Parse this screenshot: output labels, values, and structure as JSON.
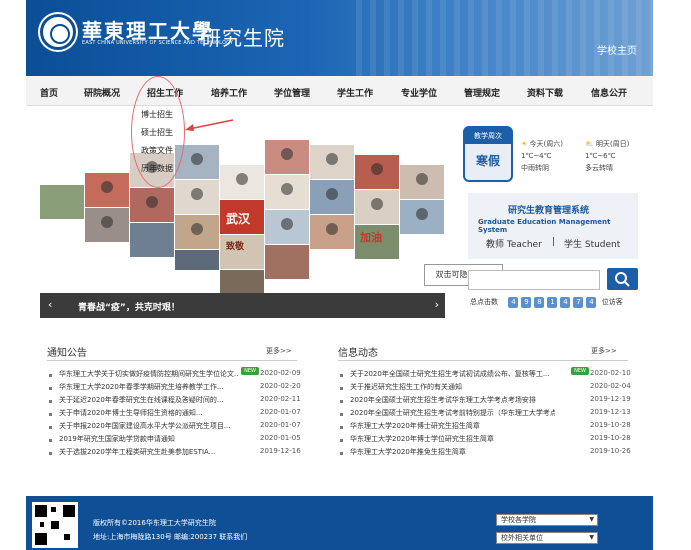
{
  "header": {
    "uni_name": "華東理工大學",
    "uni_en": "EAST CHINA UNIVERSITY OF SCIENCE AND TECHNOLOGY",
    "grad_title": "研究生院",
    "school_home": "学校主页"
  },
  "nav": {
    "items": [
      "首页",
      "研院概况",
      "招生工作",
      "培养工作",
      "学位管理",
      "学生工作",
      "专业学位",
      "管理规定",
      "资料下载",
      "信息公开"
    ]
  },
  "dropdown": {
    "items": [
      "博士招生",
      "硕士招生",
      "政策文件",
      "历年数据"
    ]
  },
  "slider": {
    "caption": "青春战“疫”，共克时艰！",
    "collage_text": [
      "武汉",
      "加油",
      "致敬"
    ]
  },
  "calendar": {
    "label": "教学周次",
    "value": "寒假"
  },
  "weather": {
    "today_label": "今天(周六)",
    "today_temp": "1℃~4℃",
    "today_desc": "中雨转阴",
    "tomorrow_label": "明天(周日)",
    "tomorrow_temp": "1℃~6℃",
    "tomorrow_desc": "多云转晴"
  },
  "gems": {
    "title": "研究生教育管理系统",
    "subtitle": "Graduate Education Management System",
    "teacher": "教师 Teacher",
    "separator": "|",
    "student": "学生 Student"
  },
  "tooltip": "双击可隐藏空白",
  "visits": {
    "label": "总点击数",
    "digits": [
      "4",
      "9",
      "8",
      "1",
      "4",
      "7",
      "4"
    ],
    "suffix": "位访客"
  },
  "notices": {
    "title": "通知公告",
    "more": "更多>>",
    "new_label": "NEW",
    "items": [
      {
        "text": "华东理工大学关于切实做好疫情防控期间研究生学位论文...",
        "date": "2020-02-09"
      },
      {
        "text": "华东理工大学2020年春季学期研究生培养教学工作...",
        "date": "2020-02-20"
      },
      {
        "text": "关于延迟2020年春季研究生在线课程及答疑时间的...",
        "date": "2020-02-11"
      },
      {
        "text": "关于申请2020年博士生导师招生资格的通知...",
        "date": "2020-01-07"
      },
      {
        "text": "关于申报2020年国家建设高水平大学公派研究生项目...",
        "date": "2020-01-07"
      },
      {
        "text": "2019年研究生国家助学贷款申请通知",
        "date": "2020-01-05"
      },
      {
        "text": "关于选拔2020学年工程类研究生赴美参加ESTIA...",
        "date": "2019-12-16"
      }
    ]
  },
  "news": {
    "title": "信息动态",
    "more": "更多>>",
    "new_label": "NEW",
    "items": [
      {
        "text": "关于2020年全国硕士研究生招生考试初试成绩公布、复核等工...",
        "date": "2020-02-10"
      },
      {
        "text": "关于推迟研究生招生工作的有关通知",
        "date": "2020-02-04"
      },
      {
        "text": "2020年全国硕士研究生招生考试华东理工大学考点考场安排",
        "date": "2019-12-19"
      },
      {
        "text": "2020年全国硕士研究生招生考试考前特别提示（华东理工大学考点）",
        "date": "2019-12-13"
      },
      {
        "text": "华东理工大学2020年博士研究生招生简章",
        "date": "2019-10-28"
      },
      {
        "text": "华东理工大学2020年博士学位研究生招生简章",
        "date": "2019-10-28"
      },
      {
        "text": "华东理工大学2020年推免生招生简章",
        "date": "2019-10-26"
      }
    ]
  },
  "footer": {
    "copyright": "版权所有©2016华东理工大学研究生院",
    "address": "地址:上海市梅陇路130号  邮编:200237  联系我们",
    "select1": "学校各学院",
    "select2": "校外相关单位"
  },
  "colors": {
    "primary": "#0b4e96",
    "accent": "#1d5ea8",
    "nav_bg": "#f3f3f3",
    "badge_green": "#3aa13a"
  }
}
